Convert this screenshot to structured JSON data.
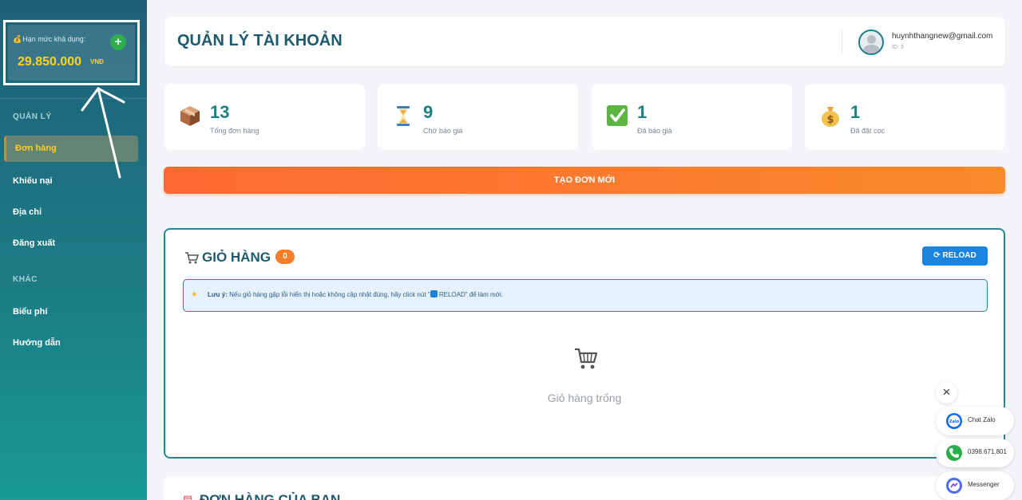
{
  "sidebar": {
    "credit_label": "Hạn mức khả dụng:",
    "credit_value": "29.850.000",
    "credit_unit": "VNĐ",
    "plus_symbol": "+",
    "section_manage": "QUẢN LÝ",
    "section_other": "KHÁC",
    "items": [
      {
        "label": "Đơn hàng",
        "active": true
      },
      {
        "label": "Khiếu nại"
      },
      {
        "label": "Địa chỉ"
      },
      {
        "label": "Đăng xuất"
      },
      {
        "label": "Biểu phí"
      },
      {
        "label": "Hướng dẫn"
      }
    ]
  },
  "header": {
    "title": "QUẢN LÝ TÀI KHOẢN",
    "email": "huynhthangnew@gmail.com",
    "user_id": "ID: 3"
  },
  "stats": [
    {
      "value": "13",
      "label": "Tổng đơn hàng",
      "icon": "package-icon"
    },
    {
      "value": "9",
      "label": "Chờ báo giá",
      "icon": "hourglass-icon"
    },
    {
      "value": "1",
      "label": "Đã báo giá",
      "icon": "checkmark-icon"
    },
    {
      "value": "1",
      "label": "Đã đặt cọc",
      "icon": "money-bag-icon"
    }
  ],
  "create_button": "TẠO ĐƠN MỚI",
  "cart": {
    "title": "GIỎ HÀNG",
    "count": "0",
    "reload_label": "RELOAD",
    "note_prefix": "Lưu ý:",
    "note_body": "Nếu giỏ hàng gặp lỗi hiển thị hoặc không cập nhật đúng, hãy click nút \"",
    "note_reload": "RELOAD",
    "note_suffix": "\" để làm mới.",
    "empty_text": "Giỏ hàng trống"
  },
  "orders": {
    "title": "ĐƠN HÀNG CỦA BẠN"
  },
  "contacts": {
    "close_symbol": "×",
    "items": [
      {
        "label": "Chat Zalo",
        "icon": "zalo-icon",
        "color": "#0a68ff"
      },
      {
        "label": "0398.671.801",
        "icon": "phone-icon",
        "color": "#27b04a"
      },
      {
        "label": "Messenger",
        "icon": "messenger-icon",
        "color": "#7b3df5"
      }
    ]
  },
  "colors": {
    "accent_orange": "#f77f2b",
    "brand_teal": "#1e7f86",
    "credit_yellow": "#ffd21a"
  }
}
